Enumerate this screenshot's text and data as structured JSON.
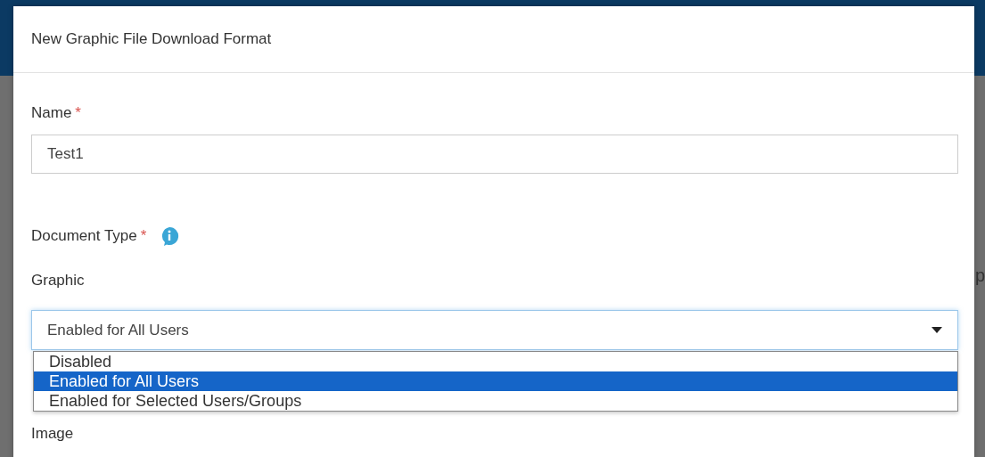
{
  "dialog": {
    "title": "New Graphic File Download Format"
  },
  "name_field": {
    "label": "Name",
    "required_mark": "*",
    "value": "Test1"
  },
  "document_type": {
    "label": "Document Type",
    "required_mark": "*"
  },
  "graphic": {
    "label": "Graphic",
    "value": "Enabled for All Users",
    "expanded": true,
    "options": [
      {
        "label": "Disabled",
        "selected": false
      },
      {
        "label": "Enabled for All Users",
        "selected": true
      },
      {
        "label": "Enabled for Selected Users/Groups",
        "selected": false
      }
    ]
  },
  "image": {
    "label": "Image"
  },
  "background_text": "p"
}
